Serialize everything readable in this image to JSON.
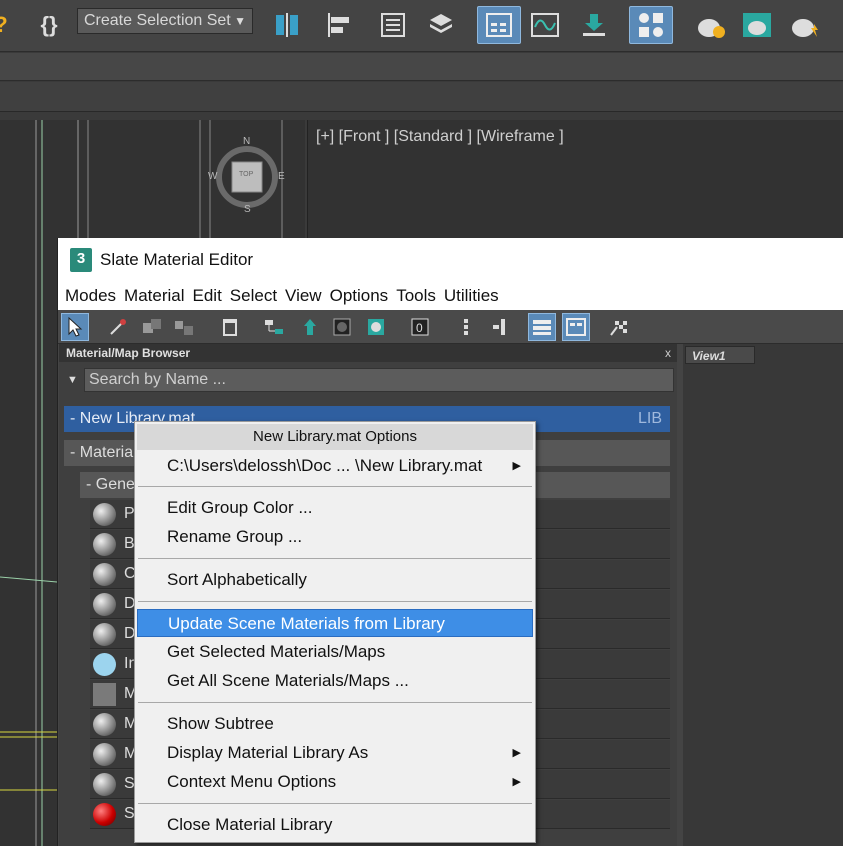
{
  "toolbar": {
    "selection_set_label": "Create Selection Set",
    "icons": [
      "help-icon",
      "script-braces-icon",
      "mirror-icon",
      "align-icon",
      "layer-list-icon",
      "layer-stack-icon",
      "toggle-scene-explorer-icon",
      "curve-editor-icon",
      "schematic-view-icon",
      "material-editor-icon",
      "render-setup-icon",
      "rendered-frame-icon",
      "render-icon"
    ]
  },
  "viewport": {
    "front_label": "[+] [Front ] [Standard ] [Wireframe ]",
    "viewcube": {
      "n": "N",
      "s": "S",
      "w": "W",
      "e": "E",
      "face": "TOP"
    }
  },
  "slate": {
    "logo": "3",
    "title": "Slate Material Editor",
    "menu": [
      "Modes",
      "Material",
      "Edit",
      "Select",
      "View",
      "Options",
      "Tools",
      "Utilities"
    ],
    "browser": {
      "title": "Material/Map Browser",
      "close": "x",
      "search_placeholder": "Search by Name ...",
      "library_label": "- New Library.mat",
      "library_tag": "LIB",
      "materials_label": "- Materia",
      "general_label": "- Gene",
      "rows": [
        {
          "name": "Ph",
          "swatch": "sphere"
        },
        {
          "name": "Bl",
          "swatch": "sphere"
        },
        {
          "name": "Cc",
          "swatch": "sphere"
        },
        {
          "name": "D",
          "swatch": "sphere"
        },
        {
          "name": "D",
          "swatch": "sphere"
        },
        {
          "name": "In",
          "swatch": "blue"
        },
        {
          "name": "M",
          "swatch": "grey"
        },
        {
          "name": "M",
          "swatch": "sphere"
        },
        {
          "name": "M",
          "swatch": "sphere"
        },
        {
          "name": "Sh",
          "swatch": "sphere"
        },
        {
          "name": "Sh",
          "swatch": "red"
        }
      ]
    },
    "view_tab": "View1"
  },
  "context_menu": {
    "header": "New Library.mat Options",
    "items": {
      "path": "C:\\Users\\delossh\\Doc ... \\New Library.mat",
      "edit_group_color": "Edit Group Color ...",
      "rename_group": "Rename Group ...",
      "sort_alpha": "Sort Alphabetically",
      "update_scene": "Update Scene Materials from Library",
      "get_selected": "Get Selected Materials/Maps",
      "get_all": "Get All Scene Materials/Maps ...",
      "show_subtree": "Show Subtree",
      "display_as": "Display Material Library As",
      "context_options": "Context Menu Options",
      "close_library": "Close Material Library"
    },
    "submenu_arrow": "▶",
    "highlight_color": "#3e8ee6"
  }
}
